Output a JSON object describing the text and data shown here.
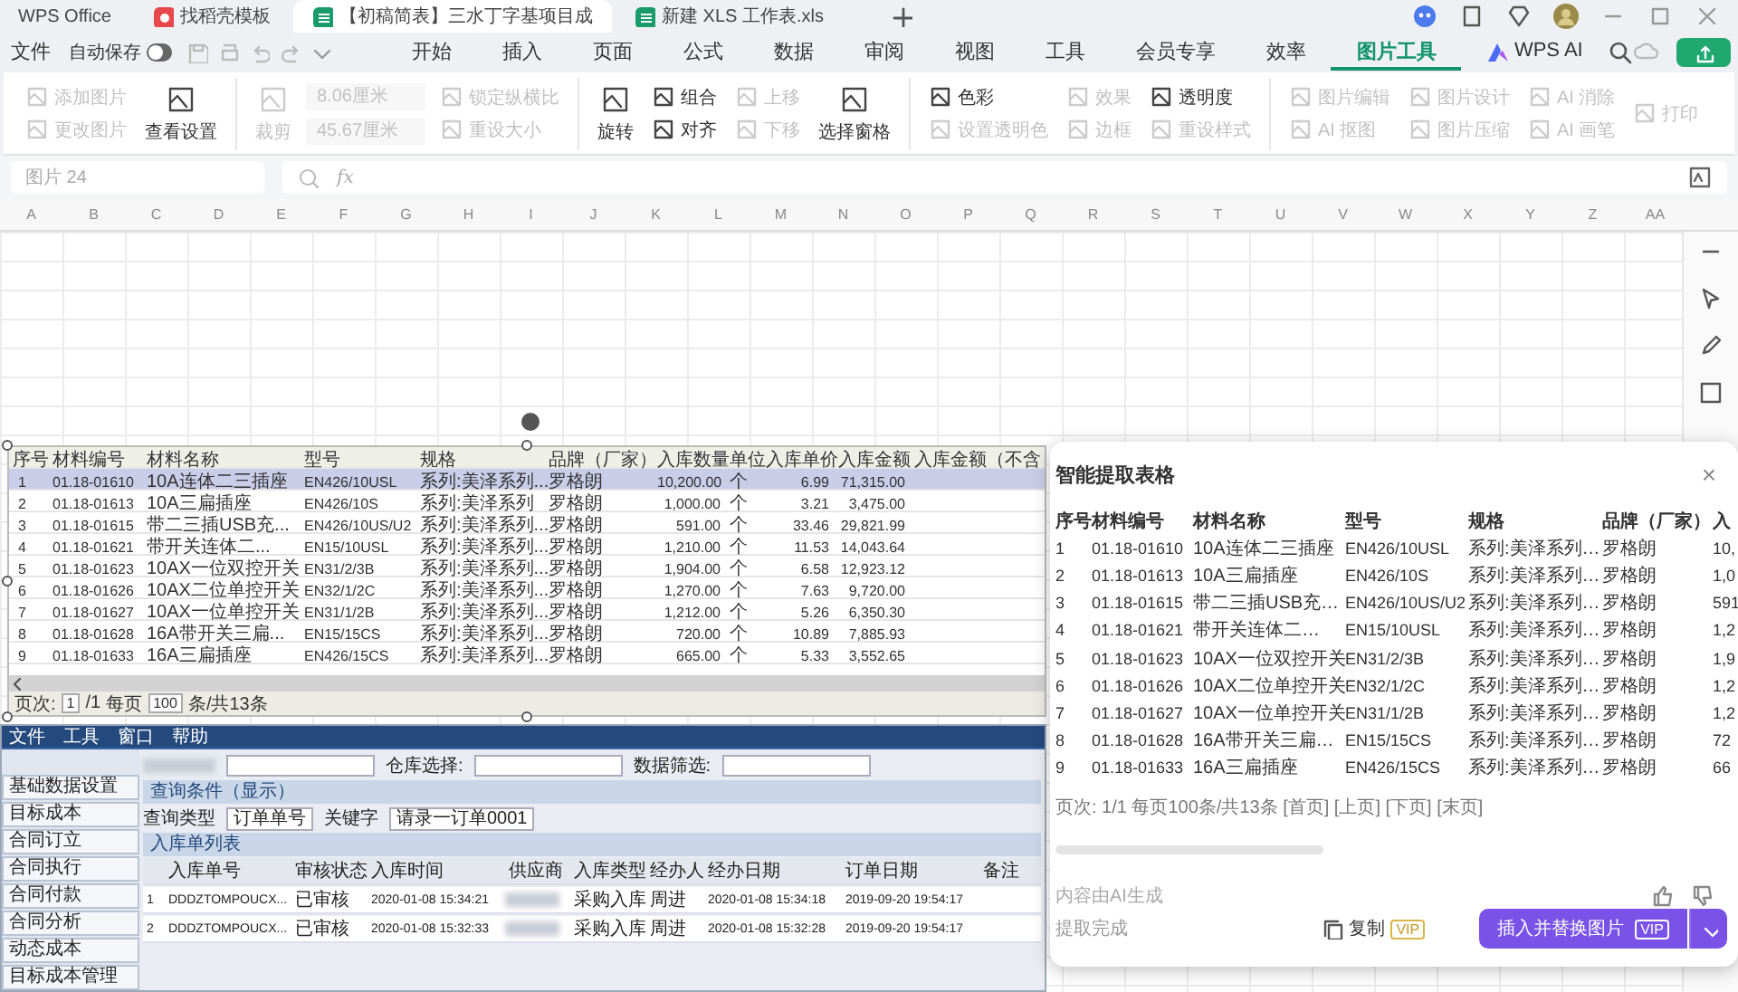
{
  "doc_tabs": [
    {
      "label": "WPS Office",
      "kind": "home",
      "selected": false
    },
    {
      "label": "找稻壳模板",
      "kind": "template",
      "selected": false
    },
    {
      "label": "【初稿简表】三水丁字基项目成",
      "kind": "sheet",
      "selected": true
    },
    {
      "label": "新建 XLS 工作表.xls",
      "kind": "sheet",
      "selected": false
    }
  ],
  "file_menu": "文件",
  "autosave": {
    "label": "自动保存",
    "on": false
  },
  "menu_tabs": [
    {
      "label": "开始",
      "selected": false
    },
    {
      "label": "插入",
      "selected": false
    },
    {
      "label": "页面",
      "selected": false
    },
    {
      "label": "公式",
      "selected": false
    },
    {
      "label": "数据",
      "selected": false
    },
    {
      "label": "审阅",
      "selected": false
    },
    {
      "label": "视图",
      "selected": false
    },
    {
      "label": "工具",
      "selected": false
    },
    {
      "label": "会员专享",
      "selected": false
    },
    {
      "label": "效率",
      "selected": false
    },
    {
      "label": "图片工具",
      "selected": true
    },
    {
      "label": "WPS AI",
      "selected": false
    }
  ],
  "ribbon": [
    {
      "columns": [
        [
          {
            "kind": "small",
            "label": "添加图片",
            "disabled": true
          },
          {
            "kind": "small",
            "label": "更改图片",
            "disabled": true
          }
        ],
        [
          {
            "kind": "big",
            "label": "查看设置",
            "disabled": false
          }
        ]
      ]
    },
    {
      "columns": [
        [
          {
            "kind": "big",
            "label": "裁剪",
            "disabled": true
          }
        ],
        [
          {
            "kind": "field",
            "label": "8.06厘米",
            "disabled": true
          },
          {
            "kind": "field",
            "label": "45.67厘米",
            "disabled": true
          }
        ],
        [
          {
            "kind": "small",
            "label": "锁定纵横比",
            "disabled": true
          },
          {
            "kind": "small",
            "label": "重设大小",
            "disabled": true
          }
        ]
      ]
    },
    {
      "columns": [
        [
          {
            "kind": "big",
            "label": "旋转",
            "disabled": false
          }
        ],
        [
          {
            "kind": "small",
            "label": "组合",
            "disabled": false
          },
          {
            "kind": "small",
            "label": "对齐",
            "disabled": false
          }
        ],
        [
          {
            "kind": "small",
            "label": "上移",
            "disabled": true
          },
          {
            "kind": "small",
            "label": "下移",
            "disabled": true
          }
        ],
        [
          {
            "kind": "big",
            "label": "选择窗格",
            "disabled": false
          }
        ]
      ]
    },
    {
      "columns": [
        [
          {
            "kind": "small",
            "label": "色彩",
            "disabled": false
          },
          {
            "kind": "small",
            "label": "设置透明色",
            "disabled": true
          }
        ],
        [
          {
            "kind": "small",
            "label": "效果",
            "disabled": true
          },
          {
            "kind": "small",
            "label": "边框",
            "disabled": true
          }
        ],
        [
          {
            "kind": "small",
            "label": "透明度",
            "disabled": false
          },
          {
            "kind": "small",
            "label": "重设样式",
            "disabled": true
          }
        ]
      ]
    },
    {
      "columns": [
        [
          {
            "kind": "small",
            "label": "图片编辑",
            "disabled": true
          },
          {
            "kind": "small",
            "label": "AI 抠图",
            "disabled": true
          }
        ],
        [
          {
            "kind": "small",
            "label": "图片设计",
            "disabled": true
          },
          {
            "kind": "small",
            "label": "图片压缩",
            "disabled": true
          }
        ],
        [
          {
            "kind": "small",
            "label": "AI 消除",
            "disabled": true
          },
          {
            "kind": "small",
            "label": "AI 画笔",
            "disabled": true
          }
        ],
        [
          {
            "kind": "small",
            "label": "打印",
            "disabled": true
          }
        ]
      ]
    }
  ],
  "name_box": "图片 24",
  "formula_label": "fx",
  "columns": [
    "A",
    "B",
    "C",
    "D",
    "E",
    "F",
    "G",
    "H",
    "I",
    "J",
    "K",
    "L",
    "M",
    "N",
    "O",
    "P",
    "Q",
    "R",
    "S",
    "T",
    "U",
    "V",
    "W",
    "X",
    "Y",
    "Z",
    "AA"
  ],
  "image_table": {
    "columns": [
      "序号",
      "材料编号",
      "材料名称",
      "型号",
      "规格",
      "品牌（厂家）",
      "入库数量",
      "单位",
      "入库单价",
      "入库金额",
      "入库金额（不含"
    ],
    "rows": [
      {
        "selected": true,
        "cells": [
          "1",
          "01.18-01610",
          "10A连体二三插座",
          "EN426/10USL",
          "系列:美泽系列...",
          "罗格朗",
          "10,200.00",
          "个",
          "6.99",
          "71,315.00"
        ]
      },
      {
        "selected": false,
        "cells": [
          "2",
          "01.18-01613",
          "10A三扁插座",
          "EN426/10S",
          "系列:美泽系列",
          "罗格朗",
          "1,000.00",
          "个",
          "3.21",
          "3,475.00"
        ]
      },
      {
        "selected": false,
        "cells": [
          "3",
          "01.18-01615",
          "带二三插USB充...",
          "EN426/10US/U2",
          "系列:美泽系列...",
          "罗格朗",
          "591.00",
          "个",
          "33.46",
          "29,821.99"
        ]
      },
      {
        "selected": false,
        "cells": [
          "4",
          "01.18-01621",
          "带开关连体二...",
          "EN15/10USL",
          "系列:美泽系列...",
          "罗格朗",
          "1,210.00",
          "个",
          "11.53",
          "14,043.64"
        ]
      },
      {
        "selected": false,
        "cells": [
          "5",
          "01.18-01623",
          "10AX一位双控开关",
          "EN31/2/3B",
          "系列:美泽系列...",
          "罗格朗",
          "1,904.00",
          "个",
          "6.58",
          "12,923.12"
        ]
      },
      {
        "selected": false,
        "cells": [
          "6",
          "01.18-01626",
          "10AX二位单控开关",
          "EN32/1/2C",
          "系列:美泽系列...",
          "罗格朗",
          "1,270.00",
          "个",
          "7.63",
          "9,720.00"
        ]
      },
      {
        "selected": false,
        "cells": [
          "7",
          "01.18-01627",
          "10AX一位单控开关",
          "EN31/1/2B",
          "系列:美泽系列...",
          "罗格朗",
          "1,212.00",
          "个",
          "5.26",
          "6,350.30"
        ]
      },
      {
        "selected": false,
        "cells": [
          "8",
          "01.18-01628",
          "16A带开关三扁...",
          "EN15/15CS",
          "系列:美泽系列...",
          "罗格朗",
          "720.00",
          "个",
          "10.89",
          "7,885.93"
        ]
      },
      {
        "selected": false,
        "cells": [
          "9",
          "01.18-01633",
          "16A三扁插座",
          "EN426/15CS",
          "系列:美泽系列...",
          "罗格朗",
          "665.00",
          "个",
          "5.33",
          "3,552.65"
        ]
      }
    ],
    "pager": {
      "label": "页次:",
      "page": "1",
      "total": "/1",
      "per_page_label": "每页",
      "per_page": "100",
      "count": "条/共13条"
    }
  },
  "erp_shot": {
    "menu": [
      "文件",
      "工具",
      "窗口",
      "帮助"
    ],
    "sidebar": [
      "基础数据设置",
      "目标成本",
      "合同订立",
      "合同执行",
      "合同付款",
      "合同分析",
      "动态成本",
      "目标成本管理"
    ],
    "warehouse_label": "仓库选择:",
    "filter_label": "数据筛选:",
    "query_title": "查询条件（显示）",
    "query_type_label": "查询类型",
    "query_type": "订单单号",
    "keyword_label": "关键字",
    "keyword": "请录一订单0001",
    "list_title": "入库单列表",
    "columns": [
      "入库单号",
      "审核状态",
      "入库时间",
      "供应商",
      "入库类型",
      "经办人",
      "经办日期",
      "订单日期",
      "备注"
    ],
    "rows": [
      {
        "no": "1",
        "order": "DDDZTOMPOUCX...",
        "status": "已审核",
        "time": "2020-01-08 15:34:21",
        "supplier_redacted": true,
        "type": "采购入库",
        "handler": "周进",
        "date": "2020-01-08 15:34:18",
        "order_date": "2019-09-20 19:54:17"
      },
      {
        "no": "2",
        "order": "DDDZTOMPOUCX...",
        "status": "已审核",
        "time": "2020-01-08 15:32:33",
        "supplier_redacted": true,
        "type": "采购入库",
        "handler": "周进",
        "date": "2020-01-08 15:32:28",
        "order_date": "2019-09-20 19:54:17"
      }
    ]
  },
  "panel": {
    "title": "智能提取表格",
    "close": "×",
    "columns": [
      "序号",
      "材料编号",
      "材料名称",
      "型号",
      "规格",
      "品牌（厂家）",
      "入"
    ],
    "rows": [
      [
        "1",
        "01.18-01610",
        "10A连体二三插座",
        "EN426/10USL",
        "系列:美泽系列…",
        "罗格朗",
        "10,"
      ],
      [
        "2",
        "01.18-01613",
        "10A三扁插座",
        "EN426/10S",
        "系列:美泽系列…",
        "罗格朗",
        "1,0"
      ],
      [
        "3",
        "01.18-01615",
        "带二三插USB充…",
        "EN426/10US/U2",
        "系列:美泽系列…",
        "罗格朗",
        "591"
      ],
      [
        "4",
        "01.18-01621",
        "带开关连体二…",
        "EN15/10USL",
        "系列:美泽系列…",
        "罗格朗",
        "1,2"
      ],
      [
        "5",
        "01.18-01623",
        "10AX一位双控开关",
        "EN31/2/3B",
        "系列:美泽系列…",
        "罗格朗",
        "1,9"
      ],
      [
        "6",
        "01.18-01626",
        "10AX二位单控开关",
        "EN32/1/2C",
        "系列:美泽系列…",
        "罗格朗",
        "1,2"
      ],
      [
        "7",
        "01.18-01627",
        "10AX一位单控开关",
        "EN31/1/2B",
        "系列:美泽系列…",
        "罗格朗",
        "1,2"
      ],
      [
        "8",
        "01.18-01628",
        "16A带开关三扁…",
        "EN15/15CS",
        "系列:美泽系列…",
        "罗格朗",
        "72"
      ],
      [
        "9",
        "01.18-01633",
        "16A三扁插座",
        "EN426/15CS",
        "系列:美泽系列…",
        "罗格朗",
        "66"
      ]
    ],
    "pager": "页次: 1/1 每页100条/共13条 [首页] [上页] [下页] [末页]",
    "ai_note": "内容由AI生成",
    "status": "提取完成",
    "copy": {
      "label": "复制",
      "badge": "VIP"
    },
    "insert": {
      "label": "插入并替换图片",
      "badge": "VIP"
    }
  }
}
